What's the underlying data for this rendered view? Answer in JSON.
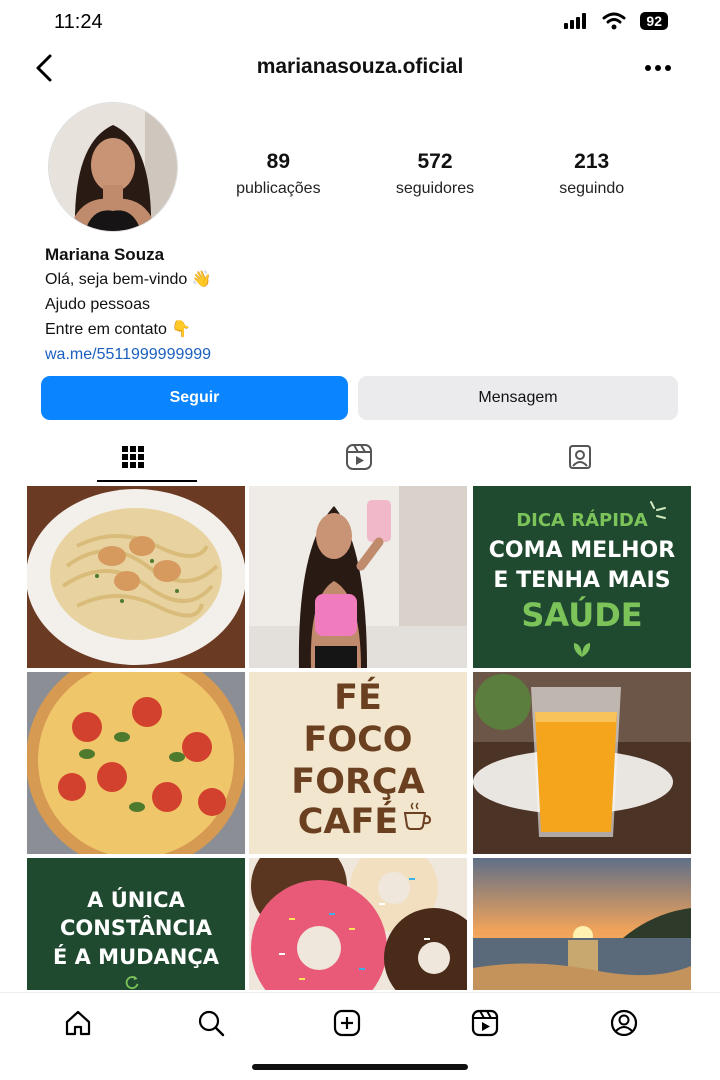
{
  "status_bar": {
    "time": "11:24",
    "battery": "92"
  },
  "header": {
    "username": "marianasouza.oficial"
  },
  "profile": {
    "stats": [
      {
        "value": "89",
        "label": "publicações"
      },
      {
        "value": "572",
        "label": "seguidores"
      },
      {
        "value": "213",
        "label": "seguindo"
      }
    ],
    "name": "Mariana Souza",
    "bio_lines": [
      "Olá, seja bem-vindo 👋",
      "Ajudo pessoas",
      "Entre em contato 👇"
    ],
    "link": "wa.me/5511999999999"
  },
  "actions": {
    "follow_label": "Seguir",
    "message_label": "Mensagem"
  },
  "tabs": [
    "grid-icon",
    "reels-icon",
    "tagged-icon"
  ],
  "posts": {
    "tip": {
      "small": "DICA RÁPIDA",
      "line1": "COMA MELHOR",
      "line2": "E TENHA MAIS",
      "big": "SAÚDE"
    },
    "faith": {
      "lines": [
        "FÉ",
        "FOCO",
        "FORÇA",
        "CAFÉ"
      ]
    },
    "quote": {
      "lines": [
        "A ÚNICA",
        "CONSTÂNCIA",
        "É A MUDANÇA"
      ]
    },
    "image_subjects": [
      "pasta-dish",
      "selfie-photo",
      "tip-card",
      "pizza",
      "faith-card",
      "orange-juice",
      "quote-card",
      "donuts",
      "sunset-beach"
    ]
  },
  "colors": {
    "accent": "#0a84ff",
    "link": "#1c5fbf",
    "tile_green": "#1f4a30",
    "tile_cream": "#f2e6cf",
    "tile_brown": "#6b4020"
  },
  "nav": [
    "home-icon",
    "search-icon",
    "create-icon",
    "reels-icon",
    "profile-icon"
  ]
}
